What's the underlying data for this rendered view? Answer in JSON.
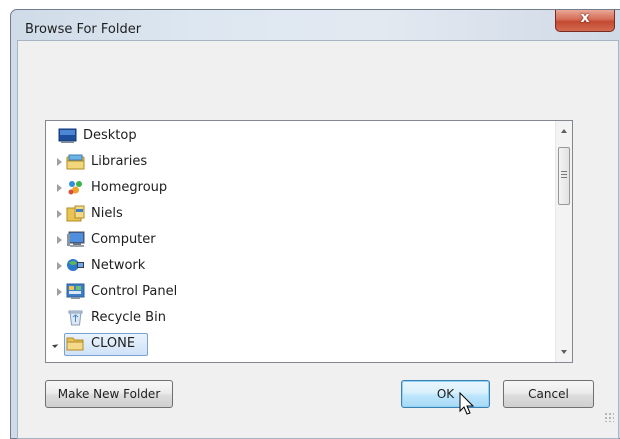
{
  "dialog": {
    "title": "Browse For Folder",
    "close_label": "x",
    "colors": {
      "close_button": "#c9503a",
      "selection_fill": "#dbeaf9",
      "ok_button": "#c5e7fa"
    }
  },
  "tree": {
    "items": [
      {
        "label": "Desktop",
        "icon": "desktop-icon",
        "expander": "none"
      },
      {
        "label": "Libraries",
        "icon": "libraries-icon",
        "expander": "collapsed"
      },
      {
        "label": "Homegroup",
        "icon": "homegroup-icon",
        "expander": "collapsed"
      },
      {
        "label": "Niels",
        "icon": "user-folder-icon",
        "expander": "collapsed"
      },
      {
        "label": "Computer",
        "icon": "computer-icon",
        "expander": "collapsed"
      },
      {
        "label": "Network",
        "icon": "network-icon",
        "expander": "collapsed"
      },
      {
        "label": "Control Panel",
        "icon": "control-panel-icon",
        "expander": "collapsed"
      },
      {
        "label": "Recycle Bin",
        "icon": "recycle-bin-icon",
        "expander": "none"
      },
      {
        "label": "CLONE",
        "icon": "folder-icon",
        "expander": "expanded",
        "selected": true
      }
    ]
  },
  "buttons": {
    "make_new_folder": "Make New Folder",
    "ok": "OK",
    "cancel": "Cancel"
  }
}
